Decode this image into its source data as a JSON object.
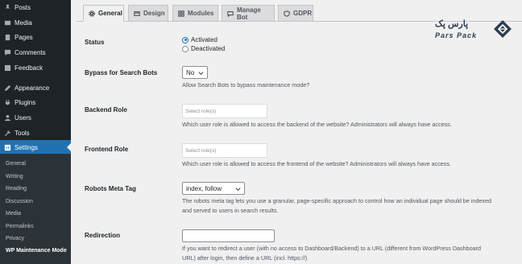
{
  "sidebar": {
    "items": [
      {
        "label": "Posts",
        "icon": "pin-icon"
      },
      {
        "label": "Media",
        "icon": "media-icon"
      },
      {
        "label": "Pages",
        "icon": "pages-icon"
      },
      {
        "label": "Comments",
        "icon": "comments-icon"
      },
      {
        "label": "Feedback",
        "icon": "feedback-icon"
      },
      {
        "label": "Appearance",
        "icon": "brush-icon"
      },
      {
        "label": "Plugins",
        "icon": "plugin-icon"
      },
      {
        "label": "Users",
        "icon": "users-icon"
      },
      {
        "label": "Tools",
        "icon": "wrench-icon"
      },
      {
        "label": "Settings",
        "icon": "settings-icon"
      }
    ],
    "submenu": [
      "General",
      "Writing",
      "Reading",
      "Discussion",
      "Media",
      "Permalinks",
      "Privacy",
      "WP Maintenance Mode"
    ],
    "active": "Settings",
    "current_sub": "WP Maintenance Mode"
  },
  "tabs": [
    {
      "label": "General",
      "icon": "gear-icon"
    },
    {
      "label": "Design",
      "icon": "design-icon"
    },
    {
      "label": "Modules",
      "icon": "modules-icon"
    },
    {
      "label": "Manage Bot",
      "icon": "chat-icon"
    },
    {
      "label": "GDPR",
      "icon": "shield-icon"
    }
  ],
  "form": {
    "status": {
      "label": "Status",
      "options": [
        "Activated",
        "Deactivated"
      ],
      "selected": "Activated"
    },
    "bypass": {
      "label": "Bypass for Search Bots",
      "value": "No",
      "help": "Allow Search Bots to bypass maintenance mode?"
    },
    "backend": {
      "label": "Backend Role",
      "placeholder": "Select role(s)",
      "help": "Which user role is allowed to access the backend of the website? Administrators will always have access."
    },
    "frontend": {
      "label": "Frontend Role",
      "placeholder": "Select role(s)",
      "help": "Which user role is allowed to access the frontend of the website? Administrators will always have access."
    },
    "robots": {
      "label": "Robots Meta Tag",
      "value": "index, follow",
      "help1": "The robots meta tag lets you use a granular, page-specific approach to control how an individual page should be indexed",
      "help2": "and served to users in search results."
    },
    "redirection": {
      "label": "Redirection",
      "value": "",
      "help1": "If you want to redirect a user (with no access to Dashboard/Backend) to a URL (different from WordPress Dashboard",
      "help2": "URL) after login, then define a URL (incl. https://)"
    }
  },
  "logo": {
    "fa": "پارس پک",
    "en": "Pars Pack"
  },
  "colors": {
    "sidebar": "#1d2327",
    "active": "#2271b1",
    "submenu": "#2c3338"
  }
}
